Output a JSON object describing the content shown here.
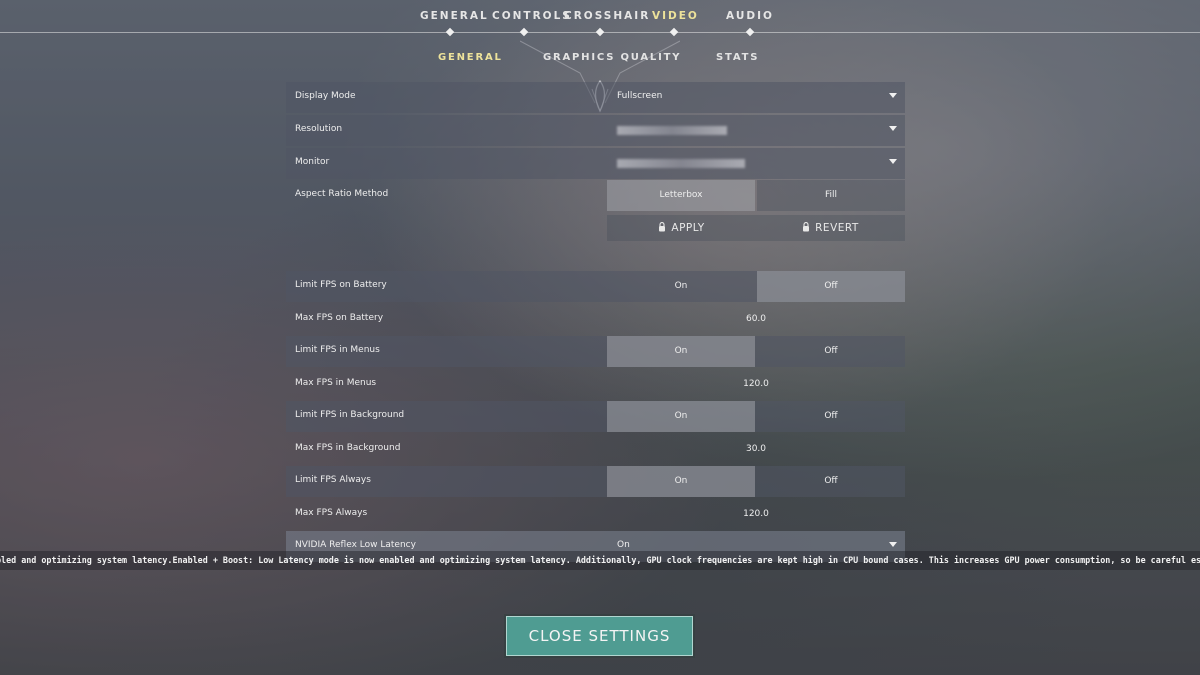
{
  "top_tabs": [
    {
      "label": "GENERAL",
      "active": false
    },
    {
      "label": "CONTROLS",
      "active": false
    },
    {
      "label": "CROSSHAIR",
      "active": false
    },
    {
      "label": "VIDEO",
      "active": true
    },
    {
      "label": "AUDIO",
      "active": false
    }
  ],
  "sub_tabs": [
    {
      "label": "GENERAL",
      "active": true
    },
    {
      "label": "GRAPHICS QUALITY",
      "active": false
    },
    {
      "label": "STATS",
      "active": false
    }
  ],
  "settings": {
    "display_mode": {
      "label": "Display Mode",
      "value": "Fullscreen"
    },
    "resolution": {
      "label": "Resolution"
    },
    "monitor": {
      "label": "Monitor"
    },
    "aspect_ratio": {
      "label": "Aspect Ratio Method",
      "options": [
        "Letterbox",
        "Fill"
      ],
      "selected": "Letterbox"
    },
    "apply_label": "APPLY",
    "revert_label": "REVERT",
    "limit_fps_battery": {
      "label": "Limit FPS on Battery",
      "on": "On",
      "off": "Off",
      "selected": "Off"
    },
    "max_fps_battery": {
      "label": "Max FPS on Battery",
      "value": "60.0"
    },
    "limit_fps_menus": {
      "label": "Limit FPS in Menus",
      "on": "On",
      "off": "Off",
      "selected": "On"
    },
    "max_fps_menus": {
      "label": "Max FPS in Menus",
      "value": "120.0"
    },
    "limit_fps_background": {
      "label": "Limit FPS in Background",
      "on": "On",
      "off": "Off",
      "selected": "On"
    },
    "max_fps_background": {
      "label": "Max FPS in Background",
      "value": "30.0"
    },
    "limit_fps_always": {
      "label": "Limit FPS Always",
      "on": "On",
      "off": "Off",
      "selected": "On"
    },
    "max_fps_always": {
      "label": "Max FPS Always",
      "value": "120.0"
    },
    "nvidia_reflex": {
      "label": "NVIDIA Reflex Low Latency",
      "value": "On"
    }
  },
  "tooltip": "bled and optimizing system latency.Enabled + Boost: Low Latency mode is now enabled and optimizing system latency.  Additionally, GPU clock frequencies are kept high in CPU bound cases.  This increases GPU power consumption, so be careful especially on laptops.",
  "close_label": "CLOSE SETTINGS",
  "colors": {
    "accent_gold": "#ede29a",
    "close_button": "#4f9c92",
    "selected_toggle": "#a0a2a8"
  }
}
